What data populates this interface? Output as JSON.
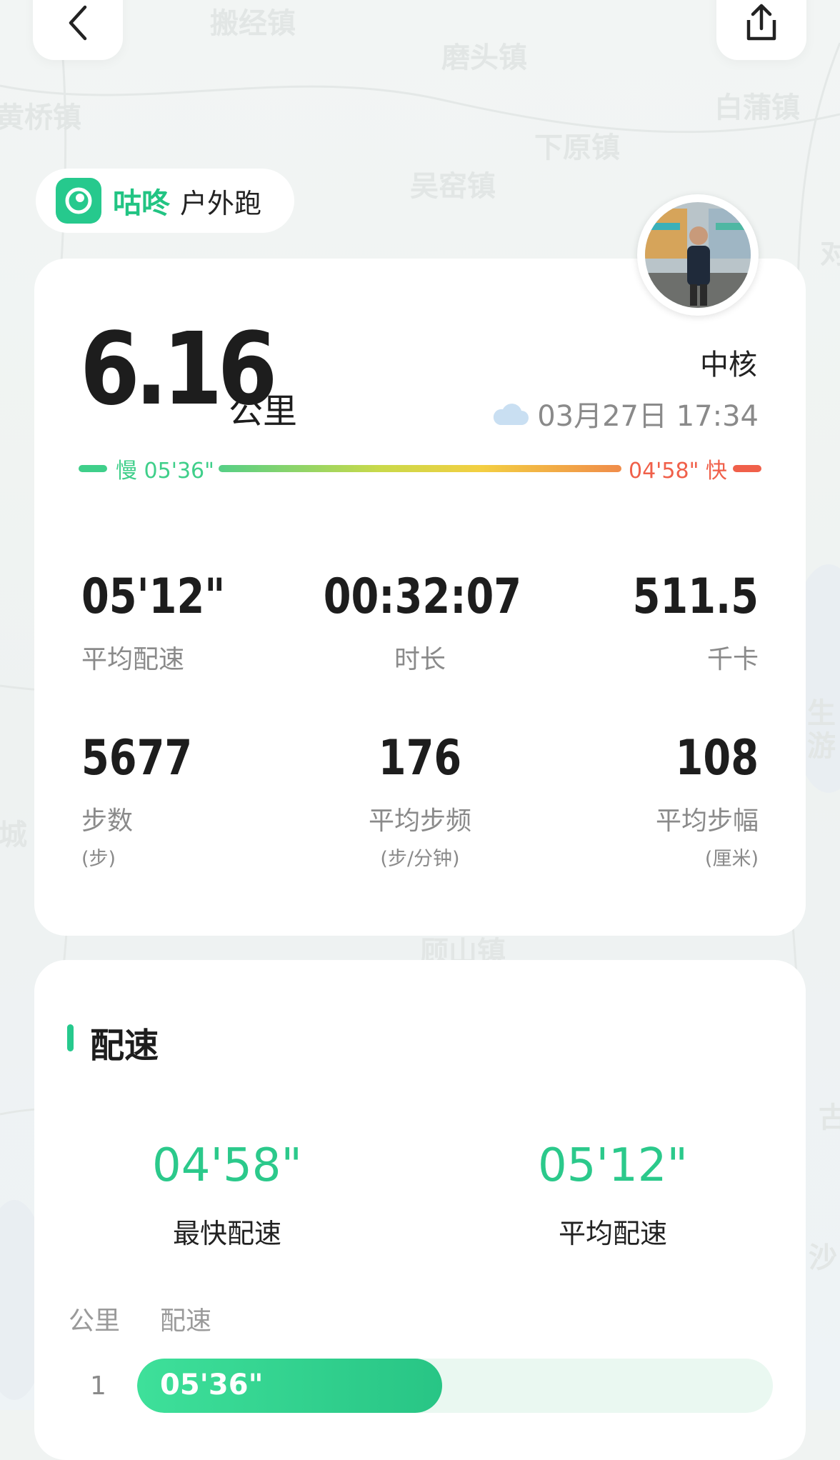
{
  "map": {
    "labels": [
      "搬经镇",
      "磨头镇",
      "黄桥镇",
      "白蒲镇",
      "下原镇",
      "吴窑镇",
      "顾山镇",
      "对",
      "生",
      "游",
      "城",
      "古",
      "沙"
    ]
  },
  "header": {
    "back_icon": "chevron-left-icon",
    "share_icon": "share-icon"
  },
  "brand": {
    "name": "咕咚",
    "activity_type": "户外跑",
    "logo_color": "#26c98d"
  },
  "summary": {
    "distance": "6.16",
    "distance_unit": "公里",
    "username": "中核",
    "weather_icon": "cloud-icon",
    "datetime": "03月27日 17:34",
    "pace_range": {
      "slow_label": "慢 05'36\"",
      "fast_label": "04'58\" 快",
      "slow_color": "#3fcf8a",
      "fast_color": "#f0604a"
    }
  },
  "stats": [
    {
      "value": "05'12\"",
      "label": "平均配速",
      "sub": ""
    },
    {
      "value": "00:32:07",
      "label": "时长",
      "sub": ""
    },
    {
      "value": "511.5",
      "label": "千卡",
      "sub": ""
    },
    {
      "value": "5677",
      "label": "步数",
      "sub": "(步)"
    },
    {
      "value": "176",
      "label": "平均步频",
      "sub": "(步/分钟)"
    },
    {
      "value": "108",
      "label": "平均步幅",
      "sub": "(厘米)"
    }
  ],
  "pace_section": {
    "title": "配速",
    "fastest": {
      "value": "04'58\"",
      "label": "最快配速"
    },
    "average": {
      "value": "05'12\"",
      "label": "平均配速"
    },
    "columns": [
      "公里",
      "配速"
    ],
    "rows": [
      {
        "km": "1",
        "pace": "05'36\"",
        "fill_fraction": 0.48
      }
    ],
    "accent": "#2bc98b"
  }
}
